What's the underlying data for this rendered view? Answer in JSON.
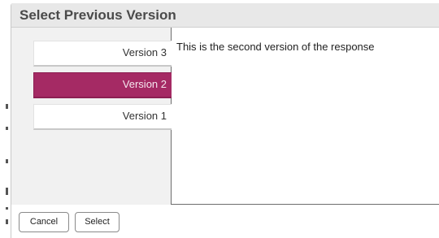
{
  "dialog": {
    "title": "Select Previous Version"
  },
  "versions": [
    {
      "label": "Version 3",
      "selected": false
    },
    {
      "label": "Version 2",
      "selected": true
    },
    {
      "label": "Version 1",
      "selected": false
    }
  ],
  "content": {
    "text": "This is the second version of the response"
  },
  "footer": {
    "cancel_label": "Cancel",
    "select_label": "Select"
  },
  "colors": {
    "selected_background": "#a52a64",
    "title_bar": "#e8e8e8",
    "sidebar": "#f1f1f1"
  }
}
